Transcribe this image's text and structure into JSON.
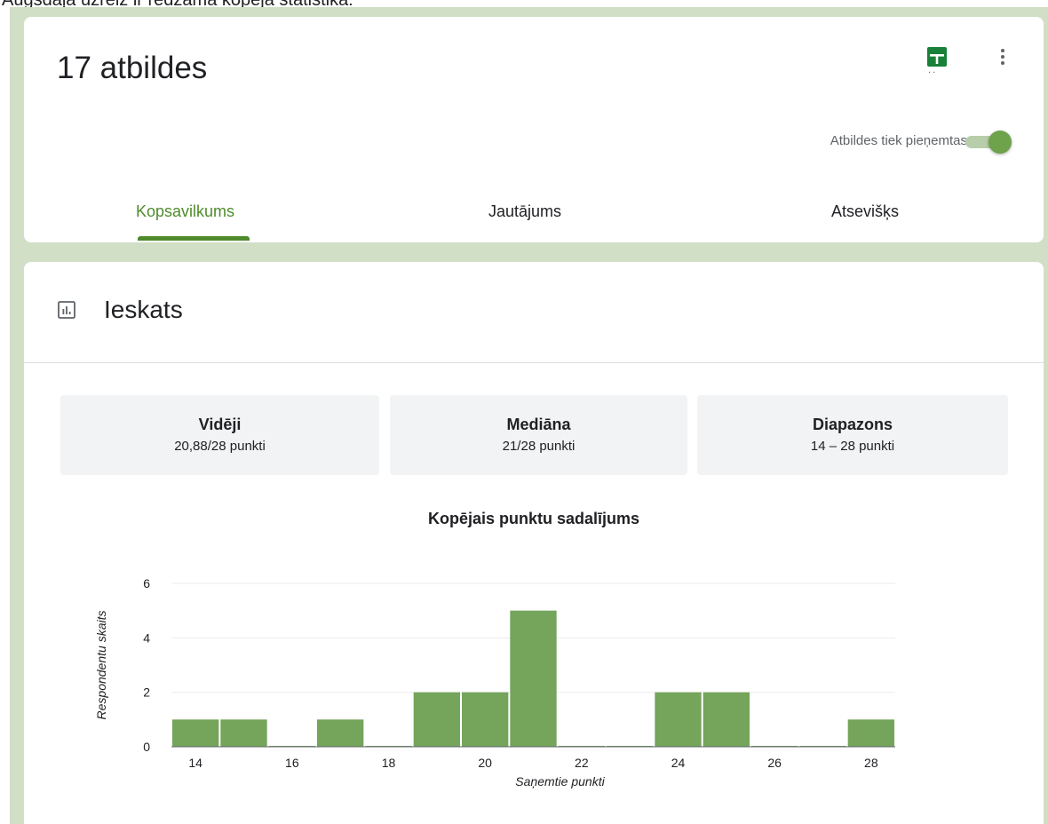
{
  "caption": "Augsdaļā uzreiz ir redzama kopējā statistika:",
  "header": {
    "title": "17 atbildes",
    "accepting_label": "Atbildes tiek pieņemtas",
    "accepting": true
  },
  "tabs": [
    {
      "label": "Kopsavilkums",
      "active": true
    },
    {
      "label": "Jautājums",
      "active": false
    },
    {
      "label": "Atsevišķs",
      "active": false
    }
  ],
  "insights": {
    "title": "Ieskats",
    "stats": [
      {
        "label": "Vidēji",
        "value": "20,88/28 punkti"
      },
      {
        "label": "Mediāna",
        "value": "21/28 punkti"
      },
      {
        "label": "Diapazons",
        "value": "14 – 28 punkti"
      }
    ]
  },
  "colors": {
    "accent": "#4f8b2c",
    "bar": "#74a55a",
    "background": "#d1dfc6"
  },
  "chart_data": {
    "type": "bar",
    "title": "Kopējais punktu sadalījums",
    "xlabel": "Saņemtie punkti",
    "ylabel": "Respondentu skaits",
    "categories": [
      14,
      15,
      16,
      17,
      18,
      19,
      20,
      21,
      22,
      23,
      24,
      25,
      26,
      27,
      28
    ],
    "values": [
      1,
      1,
      0,
      1,
      0,
      2,
      2,
      5,
      0,
      0,
      2,
      2,
      0,
      0,
      1
    ],
    "x_ticks": [
      14,
      16,
      18,
      20,
      22,
      24,
      26,
      28
    ],
    "y_ticks": [
      0,
      2,
      4,
      6
    ],
    "ylim": [
      0,
      6
    ],
    "grid": true,
    "legend": "none"
  }
}
